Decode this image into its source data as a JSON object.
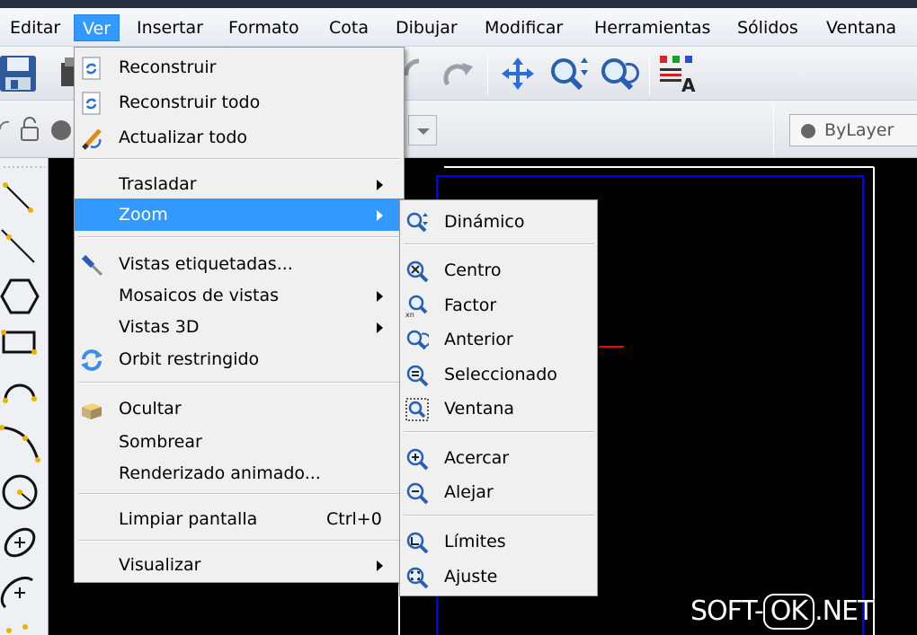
{
  "menubar": {
    "items": [
      "Editar",
      "Ver",
      "Insertar",
      "Formato",
      "Cota",
      "Dibujar",
      "Modificar",
      "Herramientas",
      "Sólidos",
      "Ventana"
    ]
  },
  "toolbar": {
    "layer_value": "ByLayer"
  },
  "ver_menu": {
    "items": [
      {
        "label": "Reconstruir",
        "icon": "rebuild-icon"
      },
      {
        "label": "Reconstruir todo",
        "icon": "rebuild-all-icon"
      },
      {
        "label": "Actualizar todo",
        "icon": "pencil-refresh-icon"
      },
      {
        "label": "Trasladar",
        "submenu": true
      },
      {
        "label": "Zoom",
        "submenu": true,
        "highlighted": true
      },
      {
        "label": "Vistas etiquetadas...",
        "icon": "screwdriver-icon"
      },
      {
        "label": "Mosaicos de vistas",
        "submenu": true
      },
      {
        "label": "Vistas 3D",
        "submenu": true
      },
      {
        "label": "Orbit restringido",
        "icon": "orbit-icon"
      },
      {
        "label": "Ocultar",
        "icon": "hide-box-icon"
      },
      {
        "label": "Sombrear"
      },
      {
        "label": "Renderizado animado..."
      },
      {
        "label": "Limpiar pantalla",
        "shortcut": "Ctrl+0"
      },
      {
        "label": "Visualizar",
        "submenu": true
      }
    ]
  },
  "zoom_menu": {
    "items": [
      {
        "label": "Dinámico",
        "icon": "zoom-dynamic-icon"
      },
      {
        "label": "Centro",
        "icon": "zoom-center-icon"
      },
      {
        "label": "Factor",
        "icon": "zoom-factor-icon"
      },
      {
        "label": "Anterior",
        "icon": "zoom-previous-icon"
      },
      {
        "label": "Seleccionado",
        "icon": "zoom-selected-icon"
      },
      {
        "label": "Ventana",
        "icon": "zoom-window-icon"
      },
      {
        "label": "Acercar",
        "icon": "zoom-in-icon"
      },
      {
        "label": "Alejar",
        "icon": "zoom-out-icon"
      },
      {
        "label": "Límites",
        "icon": "zoom-limits-icon"
      },
      {
        "label": "Ajuste",
        "icon": "zoom-extents-icon"
      }
    ]
  },
  "watermark": {
    "left": "SOFT-",
    "box": "OK",
    "right": ".NET"
  },
  "colors": {
    "highlight": "#3399ff",
    "canvas": "#000000",
    "frame_blue": "#0000ff",
    "crosshair_red": "#ff0000"
  }
}
